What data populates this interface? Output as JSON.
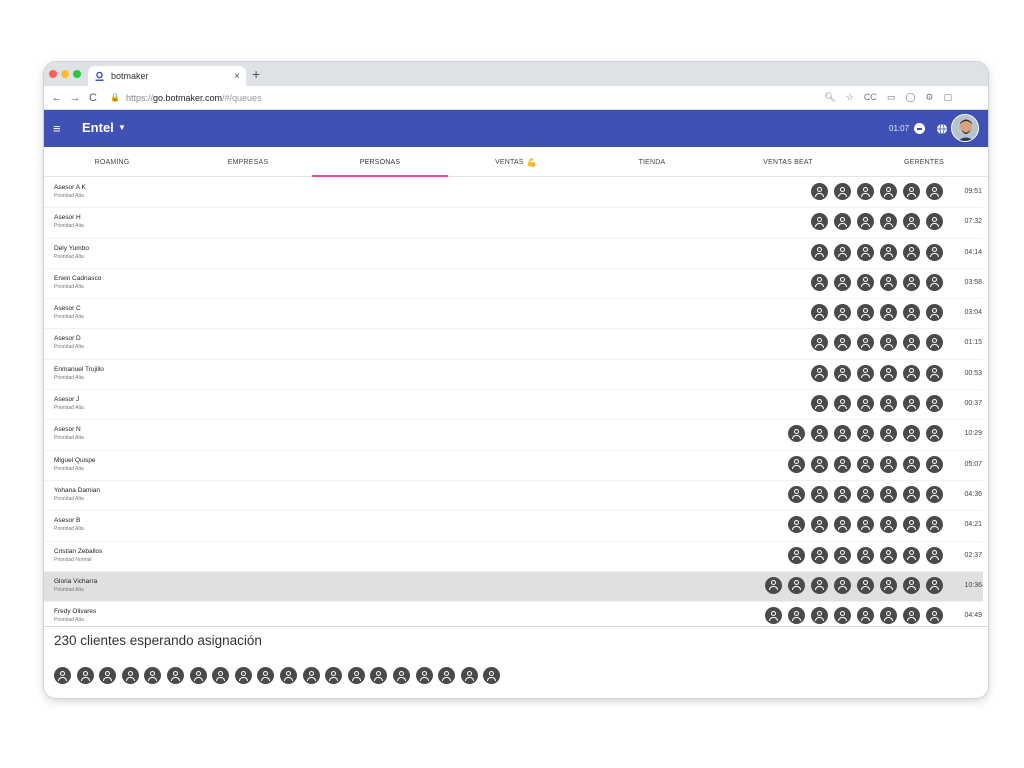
{
  "browser": {
    "tab_title": "botmaker",
    "tab_close": "×",
    "new_tab": "+",
    "url_scheme": "https://",
    "url_host": "go.botmaker.com",
    "url_path": "/#/queues"
  },
  "header": {
    "brand": "Entel",
    "time": "01:07",
    "colors": {
      "primary": "#3f51b5",
      "accent": "#e94d8f"
    }
  },
  "tabs": [
    {
      "label": "ROAMING",
      "active": false
    },
    {
      "label": "EMPRESAS",
      "active": false
    },
    {
      "label": "PERSONAS",
      "active": true
    },
    {
      "label": "VENTAS",
      "emoji": "💪",
      "active": false
    },
    {
      "label": "TIENDA",
      "active": false
    },
    {
      "label": "VENTAS BEAT",
      "active": false
    },
    {
      "label": "GERENTES",
      "active": false
    }
  ],
  "agents": [
    {
      "name": "Asesor A K",
      "priority": "Prioridad Alta",
      "clients": 6,
      "time": "09:51"
    },
    {
      "name": "Asesor H",
      "priority": "Prioridad Alta",
      "clients": 6,
      "time": "07:32"
    },
    {
      "name": "Dely Yumbo",
      "priority": "Prioridad Alta",
      "clients": 6,
      "time": "04:14"
    },
    {
      "name": "Erwin Cadriasco",
      "priority": "Prioridad Alta",
      "clients": 6,
      "time": "03:58"
    },
    {
      "name": "Asesor C",
      "priority": "Prioridad Alta",
      "clients": 6,
      "time": "03:04"
    },
    {
      "name": "Asesor D",
      "priority": "Prioridad Alta",
      "clients": 6,
      "time": "01:15"
    },
    {
      "name": "Enmanuel Trujillo",
      "priority": "Prioridad Alta",
      "clients": 6,
      "time": "00:53"
    },
    {
      "name": "Asesor J",
      "priority": "Prioridad Alta",
      "clients": 6,
      "time": "00:37"
    },
    {
      "name": "Asesor N",
      "priority": "Prioridad Alta",
      "clients": 7,
      "time": "10:29"
    },
    {
      "name": "Miguel Quispe",
      "priority": "Prioridad Alta",
      "clients": 7,
      "time": "05:07"
    },
    {
      "name": "Yohana Damian",
      "priority": "Prioridad Alta",
      "clients": 7,
      "time": "04:36"
    },
    {
      "name": "Asesor B",
      "priority": "Prioridad Alta",
      "clients": 7,
      "time": "04:21"
    },
    {
      "name": "Cristian Zeballos",
      "priority": "Prioridad Normal",
      "clients": 7,
      "time": "02:37"
    },
    {
      "name": "Gloria Vicharra",
      "priority": "Prioridad Alta",
      "clients": 8,
      "time": "10:36",
      "highlight": true
    },
    {
      "name": "Fredy Olivares",
      "priority": "Prioridad Alta",
      "clients": 8,
      "time": "04:49"
    }
  ],
  "waiting": {
    "label": "230 clientes esperando asignación",
    "visible_clients": 20
  }
}
